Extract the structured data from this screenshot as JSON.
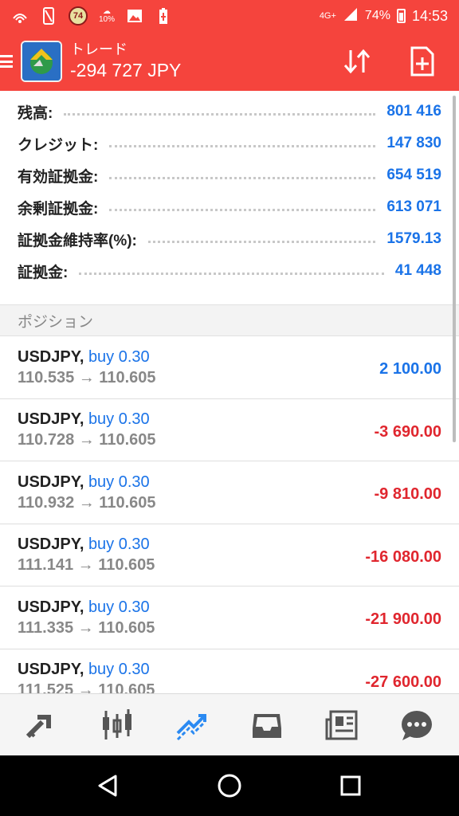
{
  "status_bar": {
    "badge_number": "74",
    "weather_percent": "10%",
    "network": "4G+",
    "battery": "74%",
    "time": "14:53"
  },
  "app_bar": {
    "title": "トレード",
    "subtitle": "-294 727 JPY"
  },
  "summary": [
    {
      "label": "残高:",
      "value": "801 416"
    },
    {
      "label": "クレジット:",
      "value": "147 830"
    },
    {
      "label": "有効証拠金:",
      "value": "654 519"
    },
    {
      "label": "余剰証拠金:",
      "value": "613 071"
    },
    {
      "label": "証拠金維持率(%):",
      "value": "1579.13"
    },
    {
      "label": "証拠金:",
      "value": "41 448"
    }
  ],
  "positions_section": {
    "title": "ポジション"
  },
  "positions": [
    {
      "symbol": "USDJPY,",
      "side": "buy 0.30",
      "prices": "110.535 → 110.605",
      "profit": "2 100.00"
    },
    {
      "symbol": "USDJPY,",
      "side": "buy 0.30",
      "prices": "110.728 → 110.605",
      "profit": "-3 690.00"
    },
    {
      "symbol": "USDJPY,",
      "side": "buy 0.30",
      "prices": "110.932 → 110.605",
      "profit": "-9 810.00"
    },
    {
      "symbol": "USDJPY,",
      "side": "buy 0.30",
      "prices": "111.141 → 110.605",
      "profit": "-16 080.00"
    },
    {
      "symbol": "USDJPY,",
      "side": "buy 0.30",
      "prices": "111.335 → 110.605",
      "profit": "-21 900.00"
    },
    {
      "symbol": "USDJPY,",
      "side": "buy 0.30",
      "prices": "111.525 → 110.605",
      "profit": "-27 600.00"
    }
  ],
  "bottom_nav": [
    {
      "icon": "quotes-icon",
      "active": false
    },
    {
      "icon": "chart-icon",
      "active": false
    },
    {
      "icon": "trade-icon",
      "active": true
    },
    {
      "icon": "history-icon",
      "active": false
    },
    {
      "icon": "news-icon",
      "active": false
    },
    {
      "icon": "messages-icon",
      "active": false
    }
  ],
  "colors": {
    "accent_red": "#f5443d",
    "value_blue": "#1a73e8",
    "loss_red": "#e0262e",
    "nav_active": "#2b8af2",
    "nav_inactive": "#555555"
  }
}
